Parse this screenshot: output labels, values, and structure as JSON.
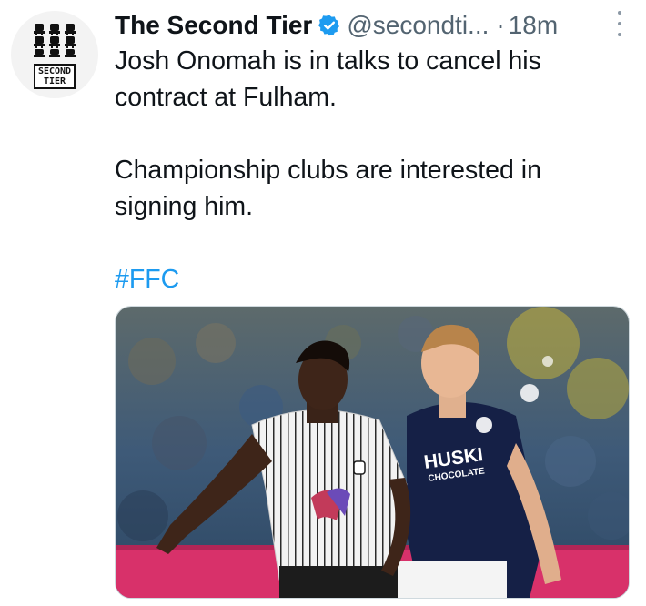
{
  "tweet": {
    "display_name": "The Second Tier",
    "handle": "@secondti...",
    "separator": "·",
    "time_ago": "18m",
    "text_lines_1": [
      "Josh Onomah is in talks to cancel his",
      "contract at Fulham."
    ],
    "text_lines_2": [
      "Championship clubs are interested in",
      "signing him."
    ],
    "hashtag": "#FFC",
    "avatar": {
      "logo_line1": "SECOND",
      "logo_line2": "TIER"
    },
    "media": {
      "sponsor_line1": "HUSKI",
      "sponsor_line2": "CHOCOLATE"
    },
    "icons": {
      "verified": "verified-badge-icon",
      "more": "more-options-icon"
    },
    "colors": {
      "text": "#0f1419",
      "secondary": "#536471",
      "link": "#1d9bf0",
      "verified": "#1d9bf0"
    }
  }
}
